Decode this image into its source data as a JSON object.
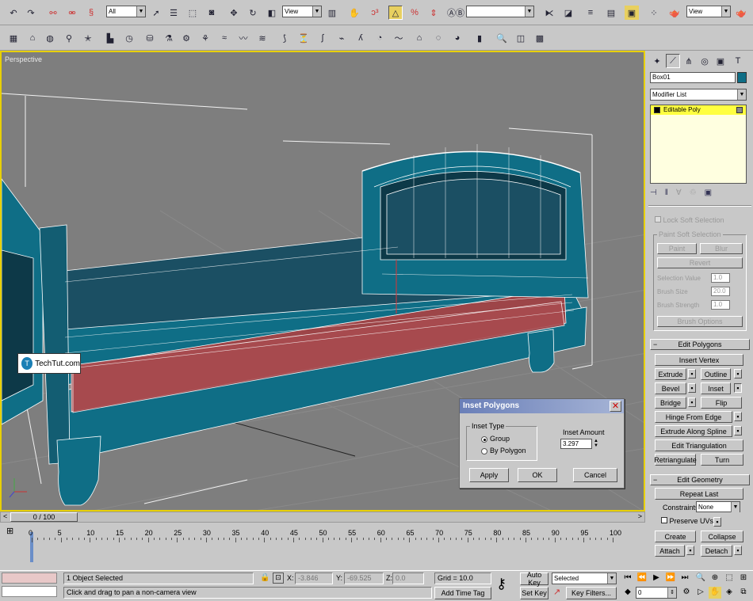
{
  "toolbar": {
    "selection_filter": "All",
    "ref_coord": "View",
    "named_sel": "",
    "ref_coord2": "View"
  },
  "viewport": {
    "label": "Perspective",
    "logo_text": "TechTut.com",
    "logo_letter": "T"
  },
  "dialog": {
    "title": "Inset Polygons",
    "inset_type_label": "Inset Type",
    "option_group": "Group",
    "option_by_polygon": "By Polygon",
    "inset_amount_label": "Inset Amount",
    "inset_amount_value": "3.297",
    "apply": "Apply",
    "ok": "OK",
    "cancel": "Cancel",
    "close": "✕"
  },
  "panel": {
    "object_name": "Box01",
    "object_color": "#0f6e86",
    "modifier_list": "Modifier List",
    "stack_item": "Editable Poly",
    "soft": {
      "lock": "Lock Soft Selection",
      "paint_group": "Paint Soft Selection",
      "paint": "Paint",
      "blur": "Blur",
      "revert": "Revert",
      "selection_value_label": "Selection Value",
      "selection_value": "1.0",
      "brush_size_label": "Brush Size",
      "brush_size": "20.0",
      "brush_strength_label": "Brush Strength",
      "brush_strength": "1.0",
      "brush_options": "Brush Options"
    },
    "edit_polygons": {
      "header": "Edit Polygons",
      "insert_vertex": "Insert Vertex",
      "extrude": "Extrude",
      "outline": "Outline",
      "bevel": "Bevel",
      "inset": "Inset",
      "bridge": "Bridge",
      "flip": "Flip",
      "hinge": "Hinge From Edge",
      "extrude_spline": "Extrude Along Spline",
      "edit_tri": "Edit Triangulation",
      "retriangulate": "Retriangulate",
      "turn": "Turn"
    },
    "edit_geometry": {
      "header": "Edit Geometry",
      "repeat_last": "Repeat Last",
      "constraints_label": "Constraints:",
      "constraints_value": "None",
      "preserve_uvs": "Preserve UVs",
      "create": "Create",
      "collapse": "Collapse",
      "attach": "Attach",
      "detach": "Detach"
    }
  },
  "timeline": {
    "frame": "0 / 100",
    "ticks": [
      "0",
      "5",
      "10",
      "15",
      "20",
      "25",
      "30",
      "35",
      "40",
      "45",
      "50",
      "55",
      "60",
      "65",
      "70",
      "75",
      "80",
      "85",
      "90",
      "95",
      "100"
    ]
  },
  "status": {
    "selected": "1 Object Selected",
    "prompt": "Click and drag to pan a non-camera view",
    "x_label": "X:",
    "x_value": "-3.846",
    "y_label": "Y:",
    "y_value": "-69.525",
    "z_label": "Z:",
    "z_value": "0.0",
    "grid": "Grid = 10.0",
    "add_time_tag": "Add Time Tag",
    "auto_key": "Auto Key",
    "set_key": "Set Key",
    "key_mode": "Selected",
    "key_filters": "Key Filters...",
    "current_frame": "0"
  }
}
